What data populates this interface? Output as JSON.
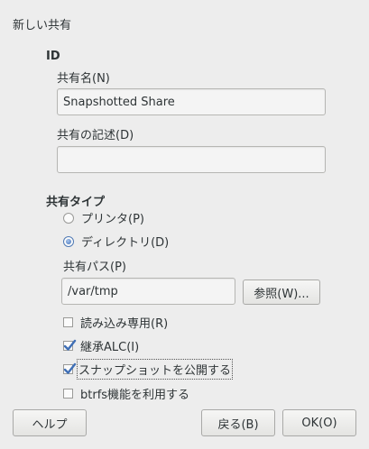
{
  "dialog": {
    "title": "新しい共有"
  },
  "id_section": {
    "heading": "ID",
    "share_name_label": "共有名(N)",
    "share_name_value": "Snapshotted Share",
    "description_label": "共有の記述(D)",
    "description_value": ""
  },
  "share_type": {
    "heading": "共有タイプ",
    "options": [
      {
        "label": "プリンタ(P)",
        "selected": false
      },
      {
        "label": "ディレクトリ(D)",
        "selected": true
      }
    ],
    "path_label": "共有パス(P)",
    "path_value": "/var/tmp",
    "browse_label": "参照(W)..."
  },
  "options": [
    {
      "label": "読み込み専用(R)",
      "checked": false
    },
    {
      "label": "継承ALC(I)",
      "checked": true
    },
    {
      "label": "スナップショットを公開する",
      "checked": true,
      "focused": true
    },
    {
      "label": "btrfs機能を利用する",
      "checked": false
    }
  ],
  "footer": {
    "help_label": "ヘルプ",
    "back_label": "戻る(B)",
    "ok_label": "OK(O)"
  },
  "colors": {
    "background": "#ededed",
    "accent": "#4a90d9",
    "text": "#2e3436"
  }
}
